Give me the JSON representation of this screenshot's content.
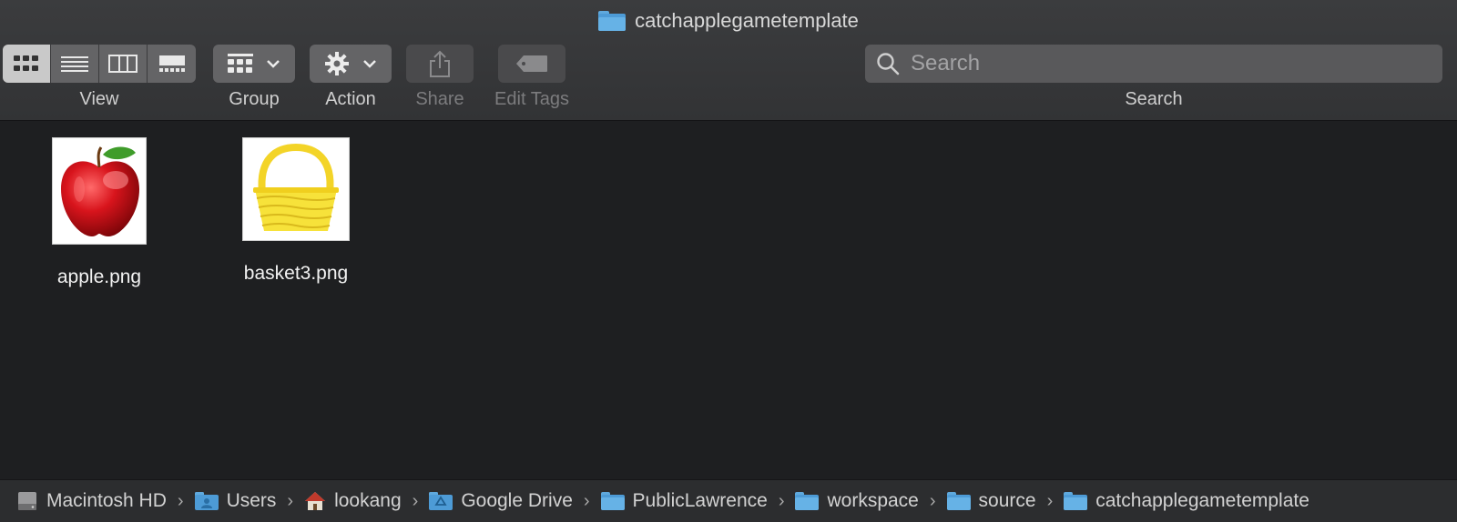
{
  "window": {
    "title": "catchapplegametemplate"
  },
  "toolbar": {
    "view_label": "View",
    "view_modes": [
      "icon-view",
      "list-view",
      "column-view",
      "gallery-view"
    ],
    "active_view": "icon-view",
    "group_label": "Group",
    "action_label": "Action",
    "share_label": "Share",
    "edit_tags_label": "Edit Tags",
    "search_label": "Search",
    "search_placeholder": "Search",
    "search_value": ""
  },
  "files": [
    {
      "name": "apple.png",
      "icon": "apple-thumbnail"
    },
    {
      "name": "basket3.png",
      "icon": "basket-thumbnail"
    }
  ],
  "pathbar": [
    {
      "label": "Macintosh HD",
      "icon": "hard-drive-icon"
    },
    {
      "label": "Users",
      "icon": "users-folder-icon"
    },
    {
      "label": "lookang",
      "icon": "home-icon"
    },
    {
      "label": "Google Drive",
      "icon": "google-drive-folder-icon"
    },
    {
      "label": "PublicLawrence",
      "icon": "folder-icon"
    },
    {
      "label": "workspace",
      "icon": "folder-icon"
    },
    {
      "label": "source",
      "icon": "folder-icon"
    },
    {
      "label": "catchapplegametemplate",
      "icon": "folder-icon"
    }
  ],
  "colors": {
    "window_bg": "#1e1f21",
    "toolbar_bg": "#38393b",
    "folder_blue": "#4d9bd6",
    "apple_red": "#c8141b",
    "basket_yellow": "#f5dc24"
  }
}
